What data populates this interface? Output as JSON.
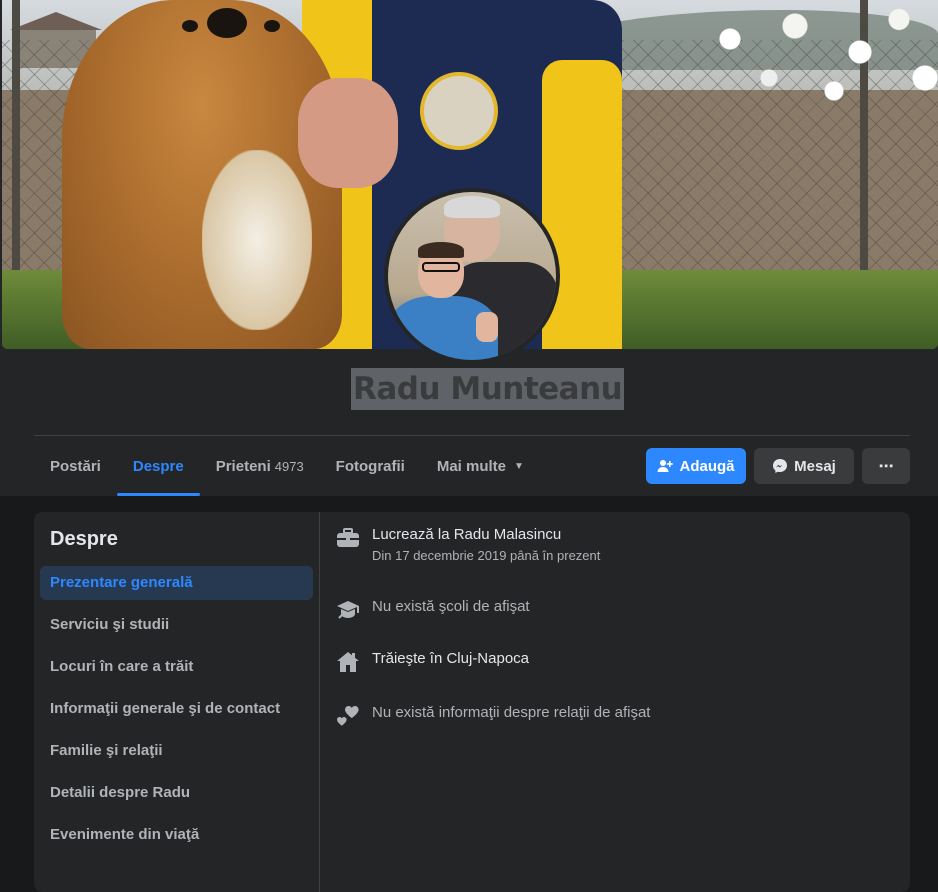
{
  "profile": {
    "name": "Radu Munteanu"
  },
  "tabs": [
    {
      "label": "Postări",
      "count": ""
    },
    {
      "label": "Despre",
      "count": ""
    },
    {
      "label": "Prieteni",
      "count": "4973"
    },
    {
      "label": "Fotografii",
      "count": ""
    },
    {
      "label": "Mai multe",
      "count": ""
    }
  ],
  "actions": {
    "add_label": "Adaugă",
    "message_label": "Mesaj",
    "more_label": "⋯"
  },
  "about": {
    "title": "Despre",
    "nav": [
      "Prezentare generală",
      "Serviciu şi studii",
      "Locuri în care a trăit",
      "Informaţii generale şi de contact",
      "Familie şi relaţii",
      "Detalii despre Radu",
      "Evenimente din viaţă"
    ],
    "work": {
      "text": "Lucrează la Radu Malasincu",
      "sub": "Din 17 decembrie 2019 până în prezent"
    },
    "education": "Nu există şcoli de afişat",
    "lives": "Trăieşte în Cluj-Napoca",
    "relationship": "Nu există informaţii despre relaţii de afişat"
  },
  "icons": {
    "work": "briefcase-icon",
    "education": "graduation-cap-icon",
    "home": "house-icon",
    "relationship": "hearts-icon",
    "add": "add-friend-icon",
    "message": "messenger-icon",
    "more": "ellipsis-icon",
    "dropdown": "caret-down-icon"
  },
  "colors": {
    "accent": "#2d88ff",
    "background": "#18191a",
    "card": "#242526"
  }
}
